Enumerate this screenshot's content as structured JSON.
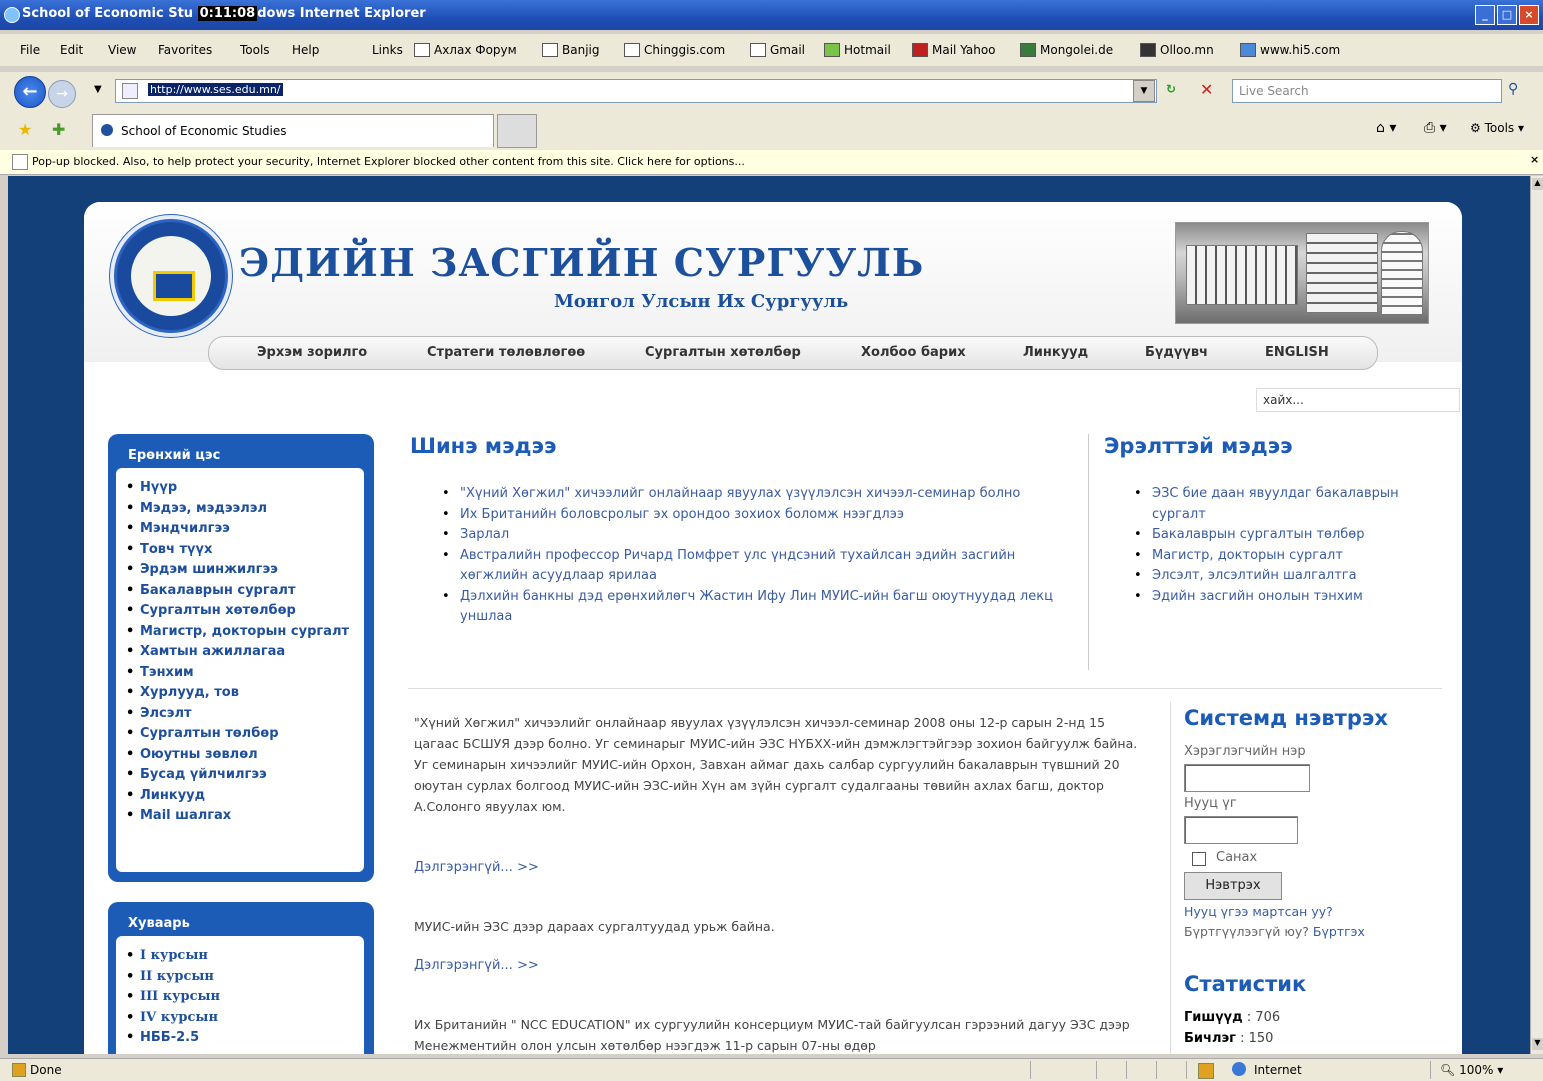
{
  "window": {
    "title_prefix": "School of Economic Stu",
    "timer": "0:11:08",
    "title_suffix": "dows Internet Explorer",
    "minimize": "_",
    "maximize": "□",
    "close": "×"
  },
  "menu": [
    "File",
    "Edit",
    "View",
    "Favorites",
    "Tools",
    "Help"
  ],
  "links": {
    "label": "Links",
    "items": [
      "Ахлах Форум",
      "Banjig",
      "Chinggis.com",
      "Gmail",
      "Hotmail",
      "Mail Yahoo",
      "Mongolei.de",
      "Olloo.mn",
      "www.hi5.com"
    ]
  },
  "address": {
    "url": "http://www.ses.edu.mn/",
    "live_search_placeholder": "Live Search"
  },
  "tabs": {
    "active_title": "School of Economic Studies",
    "tools_label": "Tools"
  },
  "popup_message": "Pop-up blocked. Also, to help protect your security, Internet Explorer blocked other content from this site. Click here for options...",
  "header": {
    "title": "ЭДИЙН ЗАСГИЙН СУРГУУЛЬ",
    "subtitle": "Монгол Улсын Их Сургууль"
  },
  "nav": [
    "Эрхэм зорилго",
    "Стратеги төлөвлөгөө",
    "Сургалтын хөтөлбөр",
    "Холбоо барих",
    "Линкууд",
    "Бүдүүвч",
    "ENGLISH"
  ],
  "search_placeholder": "хайх...",
  "sidebar": {
    "general": {
      "title": "Ерөнхий цэс",
      "items": [
        "Нүүр",
        "Мэдээ, мэдээлэл",
        "Мэндчилгээ",
        "Товч түүх",
        "Эрдэм шинжилгээ",
        "Бакалаврын сургалт",
        "Сургалтын хөтөлбөр",
        "Магистр, докторын сургалт",
        "Хамтын ажиллагаа",
        "Тэнхим",
        "Хурлууд, тов",
        "Элсэлт",
        "Сургалтын төлбөр",
        "Оюутны зөвлөл",
        "Бусад үйлчилгээ",
        "Линкууд",
        "Mail шалгах"
      ]
    },
    "schedule": {
      "title": "Хуваарь",
      "items": [
        "I курсын",
        "II курсын",
        "III курсын",
        "IV курсын",
        "НББ-2.5"
      ]
    }
  },
  "latest_news": {
    "title": "Шинэ мэдээ",
    "items": [
      "\"Хүний Хөгжил\" хичээлийг онлайнаар явуулах үзүүлэлсэн хичээл-семинар болно",
      "Их Британийн боловсролыг эх орондоо зохиох боломж нээгдлээ",
      "Зарлал",
      "Австралийн профессор Ричард Помфрет улс үндсэний тухайлсан эдийн засгийн хөгжлийн асуудлаар ярилаа",
      "Дэлхийн банкны дэд ерөнхийлөгч Жастин Ифу Лин МУИС-ийн багш оюутнуудад лекц уншлаа"
    ]
  },
  "related_news": {
    "title": "Эрэлттэй мэдээ",
    "items": [
      "ЭЗС бие даан явуулдаг бакалаврын сургалт",
      "Бакалаврын сургалтын төлбөр",
      "Магистр, докторын сургалт",
      "Элсэлт, элсэлтийн шалгалтга",
      "Эдийн засгийн онолын тэнхим"
    ]
  },
  "articles": [
    {
      "text": "\"Хүний Хөгжил\" хичээлийг онлайнаар явуулах үзүүлэлсэн хичээл-семинар 2008 оны 12-р сарын 2-нд 15 цагаас БСШУЯ дээр болно. Уг семинарыг МУИС-ийн ЭЗС НҮБХХ-ийн дэмжлэгтэйгээр зохион байгуулж байна. Уг семинарын хичээлийг МУИС-ийн Орхон, Завхан аймаг дахь салбар сургуулийн бакалаврын түвшний 20 оюутан сурлах болгоод МУИС-ийн ЭЗС-ийн Хүн ам зүйн сургалт судалгааны төвийн ахлах багш, доктор А.Солонго явуулах юм.",
      "more": "Дэлгэрэнгүй... >>"
    },
    {
      "text": "МУИС-ийн ЭЗС дээр дараах сургалтуудад урьж байна.",
      "more": "Дэлгэрэнгүй... >>"
    },
    {
      "text": "Их Британийн \" NCC EDUCATION\" их сургуулийн консерциум МУИС-тай байгуулсан гэрээний дагуу ЭЗС дээр Менежментийн олон улсын хөтөлбөр нээгдэж 11-р сарын 07-ны өдөр",
      "more": ""
    }
  ],
  "login": {
    "title": "Системд нэвтрэх",
    "username_label": "Хэрэглэгчийн нэр",
    "password_label": "Нууц үг",
    "remember_label": "Санах",
    "button": "Нэвтрэх",
    "forgot": "Нууц үгээ мартсан уу?",
    "register_prefix": "Бүртгүүлээгүй юу?",
    "register_link": "Бүртгэх"
  },
  "stats": {
    "title": "Статистик",
    "rows": [
      {
        "label": "Гишүүд",
        "value": ": 706"
      },
      {
        "label": "Бичлэг",
        "value": ": 150"
      }
    ]
  },
  "status": {
    "text": "Done",
    "zone": "Internet",
    "zoom": "100%"
  }
}
